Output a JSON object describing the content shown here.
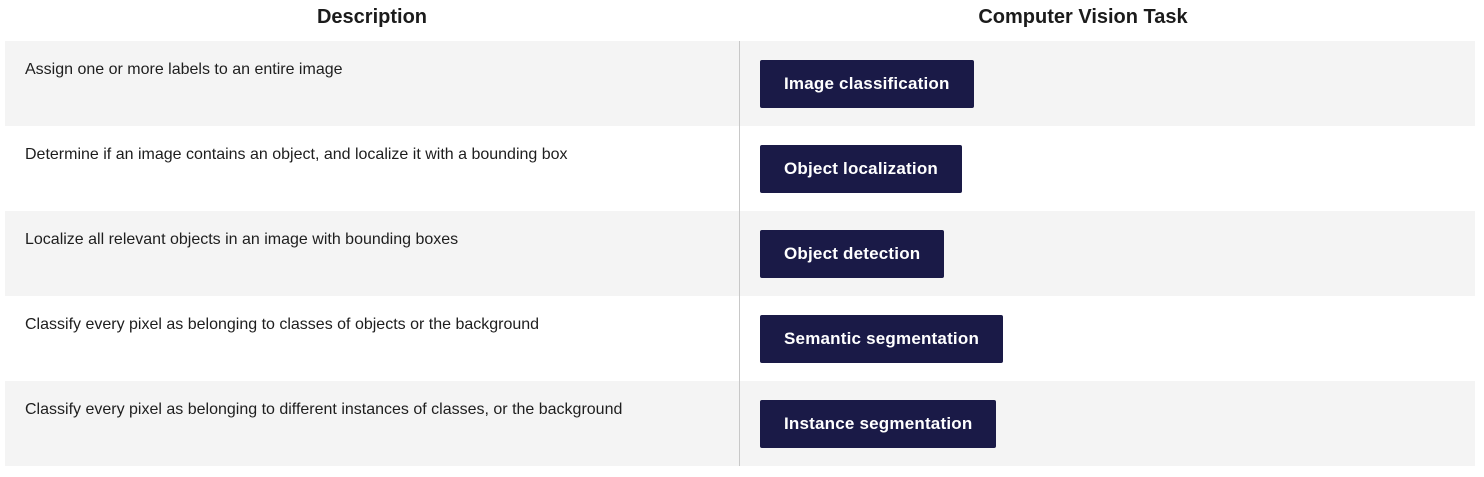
{
  "table": {
    "headers": {
      "description": "Description",
      "task": "Computer Vision Task"
    },
    "rows": [
      {
        "description": "Assign one or more labels to an entire image",
        "task": "Image classification"
      },
      {
        "description": "Determine if an image contains an object, and localize it with a bounding box",
        "task": "Object localization"
      },
      {
        "description": "Localize all relevant objects in an image with bounding boxes",
        "task": "Object detection"
      },
      {
        "description": "Classify every pixel as belonging to classes of objects or the background",
        "task": "Semantic segmentation"
      },
      {
        "description": "Classify every pixel as belonging to different instances of classes, or the background",
        "task": "Instance segmentation"
      }
    ]
  },
  "colors": {
    "button_bg": "#1a1a47",
    "button_text": "#ffffff",
    "row_shade": "#f4f4f4",
    "divider": "#c8c8c8"
  }
}
